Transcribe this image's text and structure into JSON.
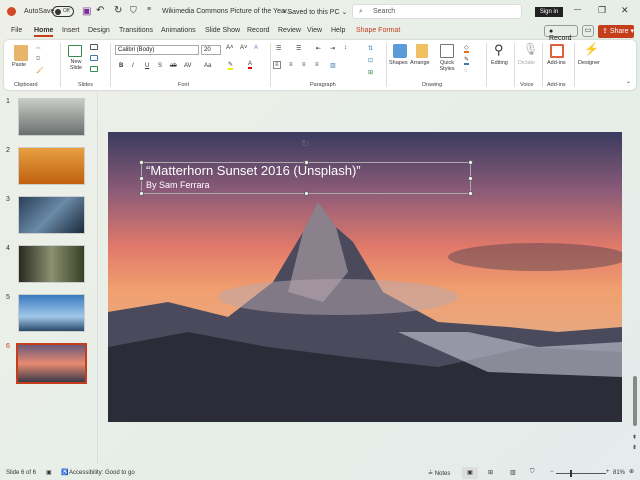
{
  "titlebar": {
    "autosave": "AutoSave",
    "toggle": "Off",
    "doc_title": "Wikimedia Commons Picture of the Year...",
    "saved": "• Saved to this PC ⌄",
    "search_placeholder": "Search",
    "signin": "Sign in"
  },
  "tabs": [
    "File",
    "Home",
    "Insert",
    "Design",
    "Transitions",
    "Animations",
    "Slide Show",
    "Record",
    "Review",
    "View",
    "Help",
    "Shape Format"
  ],
  "actions": {
    "record": "Record",
    "share": "Share"
  },
  "ribbon": {
    "clipboard": {
      "paste": "Paste",
      "group": "Clipboard"
    },
    "slides": {
      "new_slide": "New Slide",
      "group": "Slides"
    },
    "font": {
      "font_name": "Calibri (Body)",
      "font_size": "20",
      "bold": "B",
      "italic": "I",
      "underline": "U",
      "strike": "S",
      "group": "Font"
    },
    "paragraph": {
      "group": "Paragraph"
    },
    "drawing": {
      "shapes": "Shapes",
      "arrange": "Arrange",
      "quick_styles": "Quick Styles",
      "group": "Drawing"
    },
    "editing": {
      "label": "Editing"
    },
    "voice": {
      "dictate": "Dictate",
      "group": "Voice"
    },
    "addins": {
      "label": "Add-ins",
      "group": "Add-ins"
    },
    "designer": {
      "label": "Designer"
    }
  },
  "thumbnails": [
    {
      "n": "1"
    },
    {
      "n": "2"
    },
    {
      "n": "3"
    },
    {
      "n": "4"
    },
    {
      "n": "5"
    },
    {
      "n": "6",
      "selected": true
    }
  ],
  "slide": {
    "title": "“Matterhorn Sunset 2016 (Unsplash)”",
    "subtitle": "By Sam Ferrara"
  },
  "status": {
    "slide_of": "Slide 6 of 6",
    "accessibility": "Accessibility: Good to go",
    "notes": "Notes",
    "zoom": "81%"
  },
  "colors": {
    "accent": "#c43e1c",
    "share": "#c43e1c"
  }
}
